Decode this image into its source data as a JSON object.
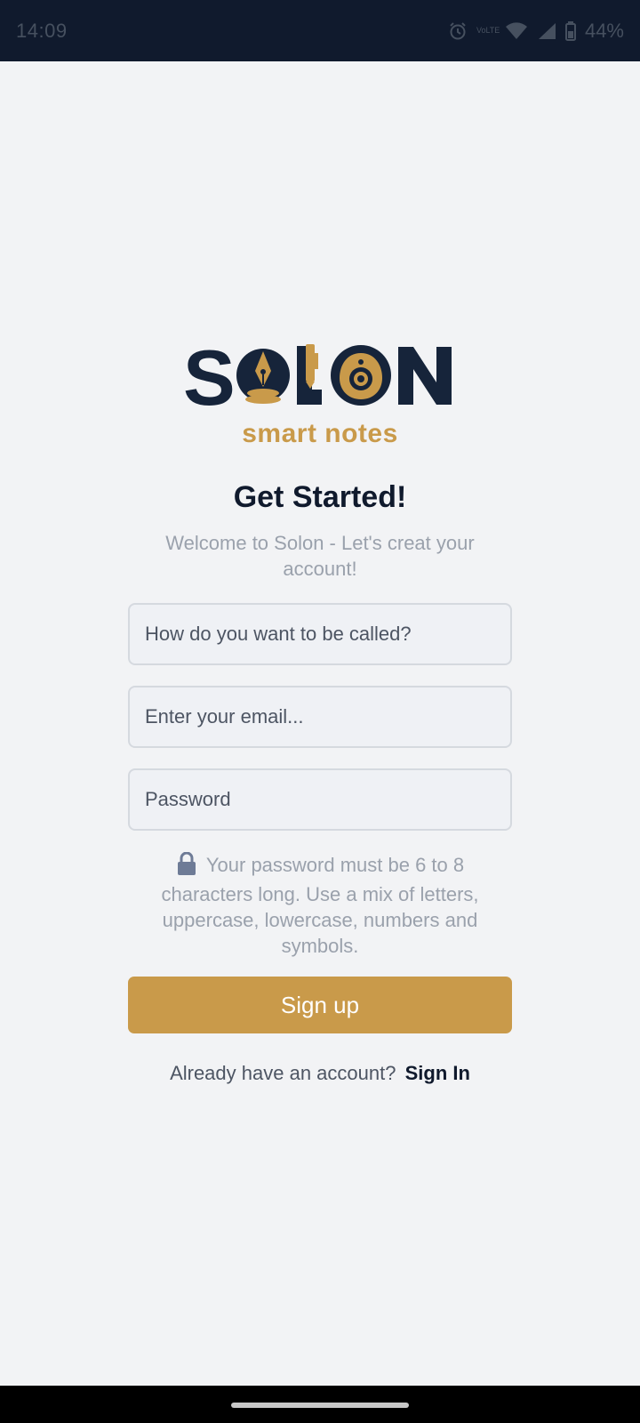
{
  "status_bar": {
    "time": "14:09",
    "battery": "44%",
    "volte": "VoLTE",
    "icons": [
      "alarm-icon",
      "volte-icon",
      "wifi-icon",
      "signal-icon",
      "battery-icon"
    ]
  },
  "logo": {
    "wordmark": "SOLON",
    "tagline": "smart notes",
    "colors": {
      "navy": "#16243a",
      "gold": "#c99a4a"
    }
  },
  "header": {
    "title": "Get Started!",
    "subtitle": "Welcome to Solon - Let's creat your account!"
  },
  "form": {
    "name_placeholder": "How do you want to be called?",
    "email_placeholder": "Enter your email...",
    "password_placeholder": "Password",
    "password_hint": "Your password must be 6 to 8 characters long. Use a mix of letters, uppercase, lowercase, numbers and symbols.",
    "submit_label": "Sign up"
  },
  "footer": {
    "prompt": "Already have an account?",
    "signin_label": "Sign In"
  },
  "colors": {
    "accent": "#c99a4a",
    "navy": "#101a2d",
    "background": "#f2f3f5"
  }
}
